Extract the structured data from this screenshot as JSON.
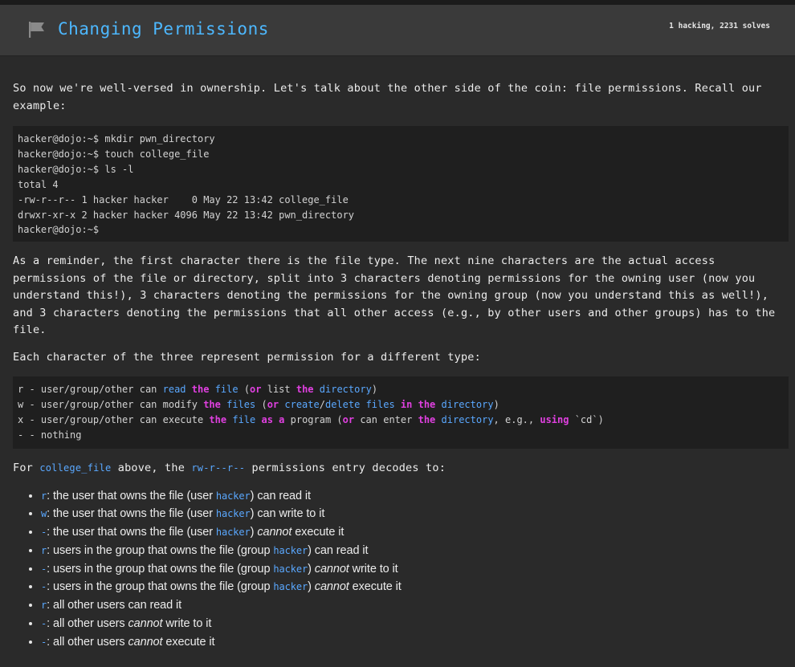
{
  "header": {
    "title": "Changing Permissions",
    "stats": "1 hacking, 2231 solves",
    "flag_icon": "flag-icon"
  },
  "intro": "So now we're well-versed in ownership. Let's talk about the other side of the coin: file permissions. Recall our example:",
  "code_example": [
    "hacker@dojo:~$ mkdir pwn_directory",
    "hacker@dojo:~$ touch college_file",
    "hacker@dojo:~$ ls -l",
    "total 4",
    "-rw-r--r-- 1 hacker hacker    0 May 22 13:42 college_file",
    "drwxr-xr-x 2 hacker hacker 4096 May 22 13:42 pwn_directory",
    "hacker@dojo:~$"
  ],
  "reminder": "As a reminder, the first character there is the file type. The next nine characters are the actual access permissions of the file or directory, split into 3 characters denoting permissions for the owning user (now you understand this!), 3 characters denoting the permissions for the owning group (now you understand this as well!), and 3 characters denoting the permissions that all other access (e.g., by other users and other groups) has to the file.",
  "each_char": "Each character of the three represent permission for a different type:",
  "perm_table": [
    "r - user/group/other can read the file (or list the directory)",
    "w - user/group/other can modify the files (or create/delete files in the directory)",
    "x - user/group/other can execute the file as a program (or can enter the directory, e.g., using `cd`)",
    "- - nothing"
  ],
  "decode": {
    "prefix": "For",
    "file": "college_file",
    "middle": "above, the",
    "perms": "rw-r--r--",
    "suffix": "permissions entry decodes to:"
  },
  "bullets": [
    {
      "code": "r",
      "pre": ": the user that owns the file (user ",
      "code2": "hacker",
      "emph": "",
      "post": ") can read it"
    },
    {
      "code": "w",
      "pre": ": the user that owns the file (user ",
      "code2": "hacker",
      "emph": "",
      "post": ") can write to it"
    },
    {
      "code": "-",
      "pre": ": the user that owns the file (user ",
      "code2": "hacker",
      "emph": "cannot",
      "post": " execute it"
    },
    {
      "code": "r",
      "pre": ": users in the group that owns the file (group ",
      "code2": "hacker",
      "emph": "",
      "post": ") can read it"
    },
    {
      "code": "-",
      "pre": ": users in the group that owns the file (group ",
      "code2": "hacker",
      "emph": "cannot",
      "post": " write to it"
    },
    {
      "code": "-",
      "pre": ": users in the group that owns the file (group ",
      "code2": "hacker",
      "emph": "cannot",
      "post": " execute it"
    },
    {
      "code": "r",
      "pre": ": all other users can read it",
      "code2": "",
      "emph": "",
      "post": ""
    },
    {
      "code": "-",
      "pre": ": all other users ",
      "code2": "",
      "emph": "cannot",
      "post": " write to it"
    },
    {
      "code": "-",
      "pre": ": all other users ",
      "code2": "",
      "emph": "cannot",
      "post": " execute it"
    }
  ],
  "colors": {
    "title": "#4db8ff",
    "keyword": "#e040e0",
    "identifier": "#5aa8ff",
    "background": "#2a2a2a",
    "header_bg": "#3a3a3a",
    "code_bg": "#1f1f1f"
  }
}
